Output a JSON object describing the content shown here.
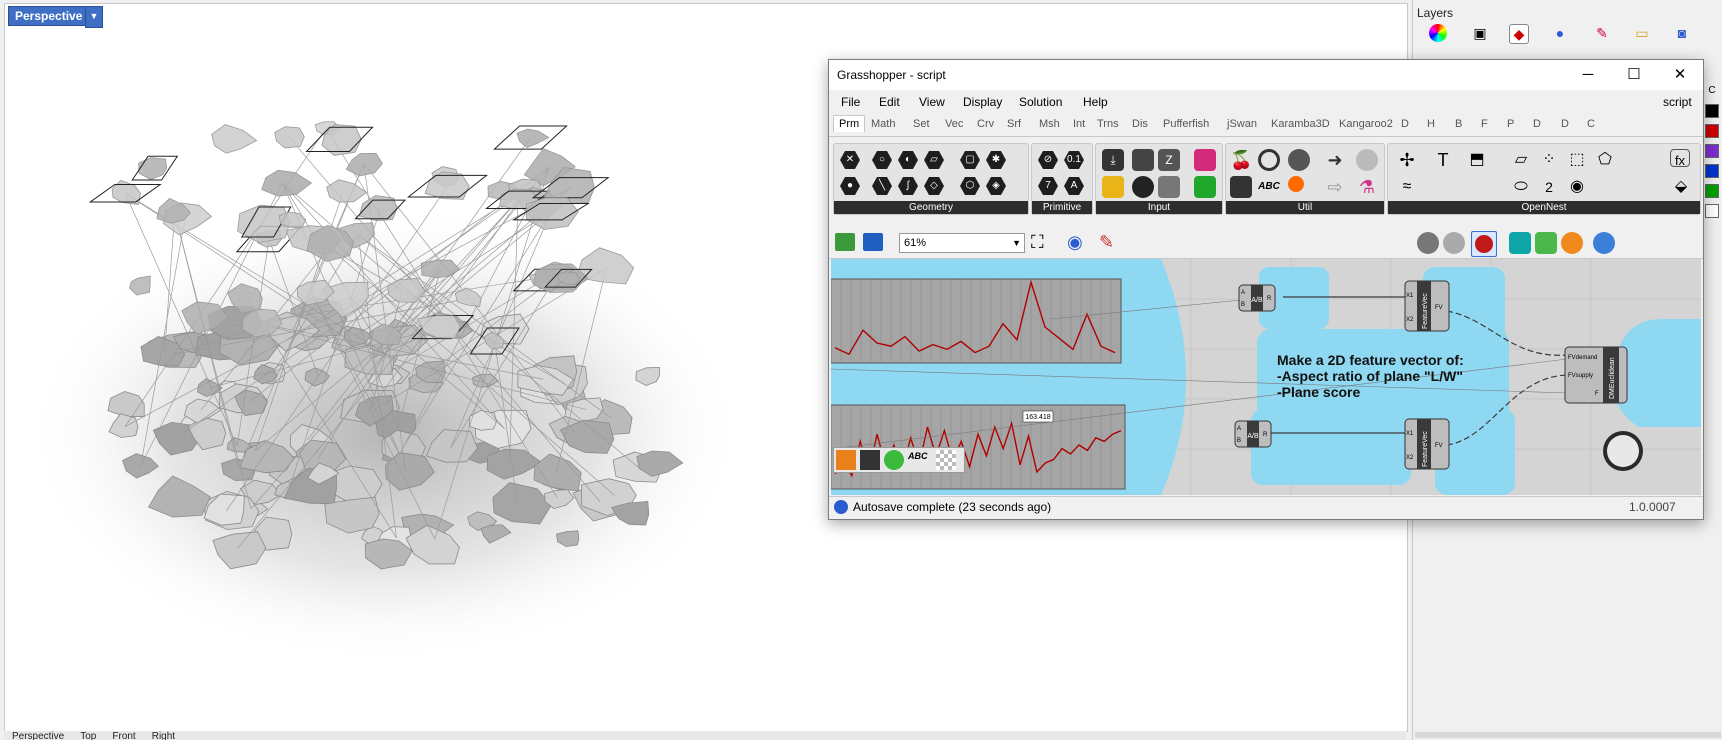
{
  "viewport": {
    "label": "Perspective",
    "bottom_tabs": [
      "Perspective",
      "Top",
      "Front",
      "Right"
    ]
  },
  "layers": {
    "title": "Layers",
    "swatch_colors": [
      "#000000",
      "#cc0000",
      "#7a2fcf",
      "#0033cc",
      "#00a000",
      "#ffffff"
    ]
  },
  "gh": {
    "title": "Grasshopper - script",
    "doc_name": "script",
    "menu": [
      "File",
      "Edit",
      "View",
      "Display",
      "Solution",
      "Help"
    ],
    "tabs": [
      "Prm",
      "Math",
      "Set",
      "Vec",
      "Crv",
      "Srf",
      "Msh",
      "Int",
      "Trns",
      "Dis",
      "Pufferfish",
      "jSwan",
      "Karamba3D",
      "Kangaroo2",
      "D",
      "H",
      "B",
      "F",
      "P",
      "D",
      "D",
      "C"
    ],
    "panels": [
      "Geometry",
      "Primitive",
      "Input",
      "Util",
      "OpenNest"
    ],
    "zoom": "61%",
    "canvas": {
      "note_lines": [
        "Make a 2D feature vector of:",
        "-Aspect ratio of plane \"L/W\"",
        "-Plane score"
      ],
      "graph_value": "163.418",
      "component_top_left": "A/B",
      "component_bottom_left": "A/B",
      "feature_vec_label": "FeatureVec",
      "dm_label": "DMEuclidean",
      "dm_inputs": [
        "FVdemand",
        "FVsupply",
        "F"
      ],
      "fv_inputs": [
        "X1",
        "X2"
      ],
      "fv_output": "FV",
      "ab_inputs": [
        "A",
        "B"
      ],
      "ab_output": "R",
      "graph_top_series": [
        7,
        3,
        18,
        10,
        8,
        14,
        5,
        9,
        6,
        11,
        4,
        8,
        22,
        12,
        48,
        20,
        13,
        6,
        28,
        8,
        4
      ],
      "graph_bottom_series": [
        4,
        10,
        3,
        22,
        5,
        26,
        8,
        20,
        6,
        24,
        9,
        30,
        14,
        28,
        11,
        22,
        8,
        26,
        14,
        30,
        18,
        32,
        9,
        25,
        5,
        10,
        12,
        18,
        15,
        20,
        17,
        24,
        22,
        26,
        28
      ]
    },
    "status": "Autosave complete (23 seconds ago)",
    "version": "1.0.0007"
  }
}
